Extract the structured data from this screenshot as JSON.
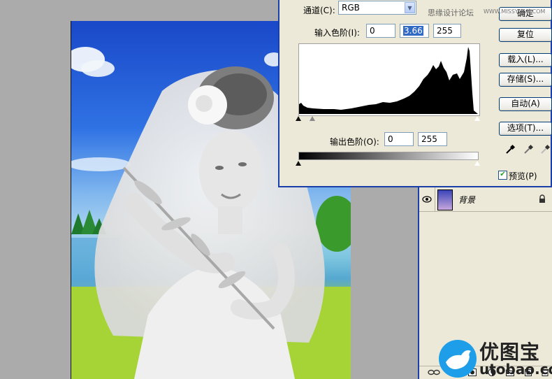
{
  "levels": {
    "channel_label": "通道(C):",
    "channel_value": "RGB",
    "input_label": "输入色阶(I):",
    "input_black": "0",
    "input_gamma": "3.66",
    "input_white": "255",
    "output_label": "输出色阶(O):",
    "output_black": "0",
    "output_white": "255",
    "buttons": {
      "ok": "确定",
      "reset": "复位",
      "load": "载入(L)...",
      "save": "存储(S)...",
      "auto": "自动(A)",
      "options": "选项(T)..."
    },
    "preview_label": "预览(P)",
    "preview_checked": true
  },
  "layers": {
    "layer_name": "背景"
  },
  "watermark": {
    "site_text": "思缘设计论坛",
    "site_url": "WWW.MISSYUAN.COM",
    "brand_cn": "优图宝",
    "brand_domain": "utobao.com"
  },
  "colors": {
    "dialog_bg": "#ece9d8",
    "title_border": "#1b3fa8",
    "selection": "#316ac5",
    "brand_blue": "#1e9ee8"
  }
}
